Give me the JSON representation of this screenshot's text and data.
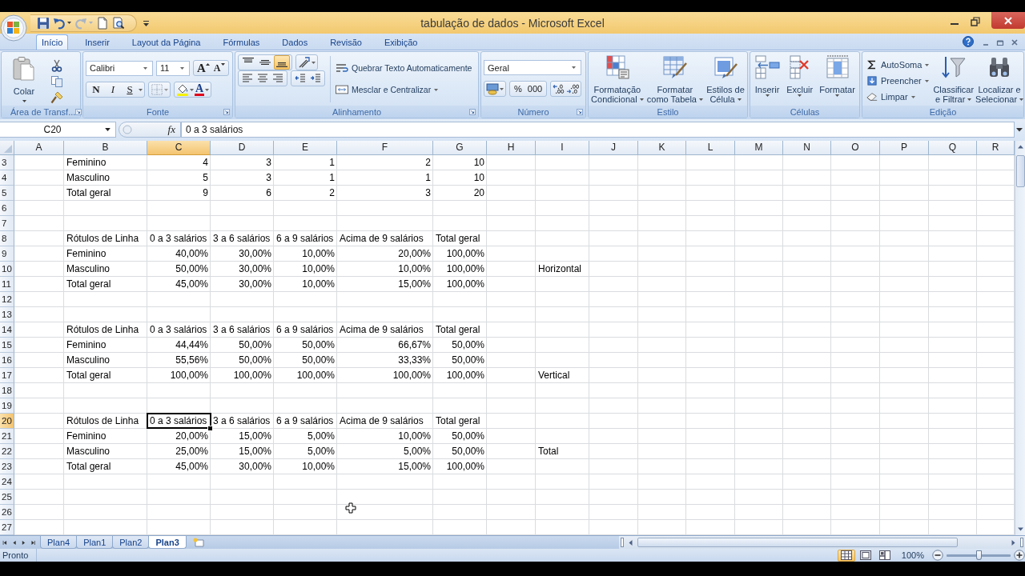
{
  "window": {
    "title": "tabulação de dados - Microsoft Excel"
  },
  "quick_access": [
    {
      "kind": "save",
      "disabled": false
    },
    {
      "kind": "undo",
      "disabled": false
    },
    {
      "kind": "redo",
      "disabled": true
    },
    {
      "kind": "new",
      "disabled": false
    },
    {
      "kind": "print_preview",
      "disabled": false
    }
  ],
  "tabs": [
    {
      "label": "Início",
      "selected": true
    },
    {
      "label": "Inserir",
      "selected": false
    },
    {
      "label": "Layout da Página",
      "selected": false
    },
    {
      "label": "Fórmulas",
      "selected": false
    },
    {
      "label": "Dados",
      "selected": false
    },
    {
      "label": "Revisão",
      "selected": false
    },
    {
      "label": "Exibição",
      "selected": false
    }
  ],
  "ribbon": {
    "clipboard": {
      "label": "Área de Transf...",
      "paste": "Colar"
    },
    "font": {
      "label": "Fonte",
      "font_name": "Calibri",
      "font_size": "11",
      "grow": "A",
      "shrink": "A",
      "styles": [
        "N",
        "I",
        "S"
      ],
      "font_color": "A"
    },
    "alignment": {
      "label": "Alinhamento",
      "vertical": [
        {
          "kind": "top",
          "selected": false
        },
        {
          "kind": "middle",
          "selected": false
        },
        {
          "kind": "bottom",
          "selected": true
        }
      ],
      "wrap": "Quebrar Texto Automaticamente",
      "merge": "Mesclar e Centralizar"
    },
    "number": {
      "label": "Número",
      "format": "Geral",
      "percent": "%",
      "thousands": "000"
    },
    "styles": {
      "label": "Estilo",
      "buttons": [
        {
          "lines": [
            "Formatação",
            "Condicional"
          ]
        },
        {
          "lines": [
            "Formatar",
            "como Tabela"
          ]
        },
        {
          "lines": [
            "Estilos de",
            "Célula"
          ]
        }
      ]
    },
    "cells": {
      "label": "Células",
      "buttons": [
        "Inserir",
        "Excluir",
        "Formatar"
      ]
    },
    "editing": {
      "label": "Edição",
      "small": [
        "AutoSoma",
        "Preencher",
        "Limpar"
      ],
      "big": [
        {
          "lines": [
            "Classificar",
            "e Filtrar"
          ]
        },
        {
          "lines": [
            "Localizar e",
            "Selecionar"
          ]
        }
      ]
    }
  },
  "formula_bar": {
    "name_box": "C20",
    "function_button": "fx",
    "formula": "0 a 3 salários"
  },
  "columns": [
    {
      "label": "A",
      "selected": false
    },
    {
      "label": "B",
      "selected": false
    },
    {
      "label": "C",
      "selected": true
    },
    {
      "label": "D",
      "selected": false
    },
    {
      "label": "E",
      "selected": false
    },
    {
      "label": "F",
      "selected": false
    },
    {
      "label": "G",
      "selected": false
    },
    {
      "label": "H",
      "selected": false
    },
    {
      "label": "I",
      "selected": false
    },
    {
      "label": "J",
      "selected": false
    },
    {
      "label": "K",
      "selected": false
    },
    {
      "label": "L",
      "selected": false
    },
    {
      "label": "M",
      "selected": false
    },
    {
      "label": "N",
      "selected": false
    },
    {
      "label": "O",
      "selected": false
    },
    {
      "label": "P",
      "selected": false
    },
    {
      "label": "Q",
      "selected": false
    },
    {
      "label": "R",
      "selected": false
    }
  ],
  "rows": [
    {
      "number": "3",
      "selected": false,
      "cells": [
        null,
        {
          "text": "Feminino",
          "kind": "text"
        },
        {
          "text": "4",
          "kind": "number"
        },
        {
          "text": "3",
          "kind": "number"
        },
        {
          "text": "1",
          "kind": "number"
        },
        {
          "text": "2",
          "kind": "number"
        },
        {
          "text": "10",
          "kind": "number"
        }
      ]
    },
    {
      "number": "4",
      "selected": false,
      "cells": [
        null,
        {
          "text": "Masculino",
          "kind": "text"
        },
        {
          "text": "5",
          "kind": "number"
        },
        {
          "text": "3",
          "kind": "number"
        },
        {
          "text": "1",
          "kind": "number"
        },
        {
          "text": "1",
          "kind": "number"
        },
        {
          "text": "10",
          "kind": "number"
        }
      ]
    },
    {
      "number": "5",
      "selected": false,
      "cells": [
        null,
        {
          "text": "Total geral",
          "kind": "text"
        },
        {
          "text": "9",
          "kind": "number"
        },
        {
          "text": "6",
          "kind": "number"
        },
        {
          "text": "2",
          "kind": "number"
        },
        {
          "text": "3",
          "kind": "number"
        },
        {
          "text": "20",
          "kind": "number"
        }
      ]
    },
    {
      "number": "6",
      "selected": false
    },
    {
      "number": "7",
      "selected": false
    },
    {
      "number": "8",
      "selected": false,
      "cells": [
        null,
        {
          "text": "Rótulos de Linha",
          "kind": "text"
        },
        {
          "text": "0 a 3 salários",
          "kind": "text"
        },
        {
          "text": "3 a 6 salários",
          "kind": "text"
        },
        {
          "text": "6 a 9 salários",
          "kind": "text"
        },
        {
          "text": "Acima de 9 salários",
          "kind": "text"
        },
        {
          "text": "Total geral",
          "kind": "text"
        }
      ]
    },
    {
      "number": "9",
      "selected": false,
      "cells": [
        null,
        {
          "text": "Feminino",
          "kind": "text"
        },
        {
          "text": "40,00%",
          "kind": "number"
        },
        {
          "text": "30,00%",
          "kind": "number"
        },
        {
          "text": "10,00%",
          "kind": "number"
        },
        {
          "text": "20,00%",
          "kind": "number"
        },
        {
          "text": "100,00%",
          "kind": "number"
        }
      ]
    },
    {
      "number": "10",
      "selected": false,
      "cells": [
        null,
        {
          "text": "Masculino",
          "kind": "text"
        },
        {
          "text": "50,00%",
          "kind": "number"
        },
        {
          "text": "30,00%",
          "kind": "number"
        },
        {
          "text": "10,00%",
          "kind": "number"
        },
        {
          "text": "10,00%",
          "kind": "number"
        },
        {
          "text": "100,00%",
          "kind": "number"
        },
        null,
        {
          "text": "Horizontal",
          "kind": "text"
        }
      ]
    },
    {
      "number": "11",
      "selected": false,
      "cells": [
        null,
        {
          "text": "Total geral",
          "kind": "text"
        },
        {
          "text": "45,00%",
          "kind": "number"
        },
        {
          "text": "30,00%",
          "kind": "number"
        },
        {
          "text": "10,00%",
          "kind": "number"
        },
        {
          "text": "15,00%",
          "kind": "number"
        },
        {
          "text": "100,00%",
          "kind": "number"
        }
      ]
    },
    {
      "number": "12",
      "selected": false
    },
    {
      "number": "13",
      "selected": false
    },
    {
      "number": "14",
      "selected": false,
      "cells": [
        null,
        {
          "text": "Rótulos de Linha",
          "kind": "text"
        },
        {
          "text": "0 a 3 salários",
          "kind": "text"
        },
        {
          "text": "3 a 6 salários",
          "kind": "text"
        },
        {
          "text": "6 a 9 salários",
          "kind": "text"
        },
        {
          "text": "Acima de 9 salários",
          "kind": "text"
        },
        {
          "text": "Total geral",
          "kind": "text"
        }
      ]
    },
    {
      "number": "15",
      "selected": false,
      "cells": [
        null,
        {
          "text": "Feminino",
          "kind": "text"
        },
        {
          "text": "44,44%",
          "kind": "number"
        },
        {
          "text": "50,00%",
          "kind": "number"
        },
        {
          "text": "50,00%",
          "kind": "number"
        },
        {
          "text": "66,67%",
          "kind": "number"
        },
        {
          "text": "50,00%",
          "kind": "number"
        }
      ]
    },
    {
      "number": "16",
      "selected": false,
      "cells": [
        null,
        {
          "text": "Masculino",
          "kind": "text"
        },
        {
          "text": "55,56%",
          "kind": "number"
        },
        {
          "text": "50,00%",
          "kind": "number"
        },
        {
          "text": "50,00%",
          "kind": "number"
        },
        {
          "text": "33,33%",
          "kind": "number"
        },
        {
          "text": "50,00%",
          "kind": "number"
        }
      ]
    },
    {
      "number": "17",
      "selected": false,
      "cells": [
        null,
        {
          "text": "Total geral",
          "kind": "text"
        },
        {
          "text": "100,00%",
          "kind": "number"
        },
        {
          "text": "100,00%",
          "kind": "number"
        },
        {
          "text": "100,00%",
          "kind": "number"
        },
        {
          "text": "100,00%",
          "kind": "number"
        },
        {
          "text": "100,00%",
          "kind": "number"
        },
        null,
        {
          "text": "Vertical",
          "kind": "text"
        }
      ]
    },
    {
      "number": "18",
      "selected": false
    },
    {
      "number": "19",
      "selected": false
    },
    {
      "number": "20",
      "selected": true,
      "cells": [
        null,
        {
          "text": "Rótulos de Linha",
          "kind": "text"
        },
        {
          "text": "0 a 3 salários",
          "kind": "text"
        },
        {
          "text": "3 a 6 salários",
          "kind": "text"
        },
        {
          "text": "6 a 9 salários",
          "kind": "text"
        },
        {
          "text": "Acima de 9 salários",
          "kind": "text"
        },
        {
          "text": "Total geral",
          "kind": "text"
        }
      ]
    },
    {
      "number": "21",
      "selected": false,
      "cells": [
        null,
        {
          "text": "Feminino",
          "kind": "text"
        },
        {
          "text": "20,00%",
          "kind": "number"
        },
        {
          "text": "15,00%",
          "kind": "number"
        },
        {
          "text": "5,00%",
          "kind": "number"
        },
        {
          "text": "10,00%",
          "kind": "number"
        },
        {
          "text": "50,00%",
          "kind": "number"
        }
      ]
    },
    {
      "number": "22",
      "selected": false,
      "cells": [
        null,
        {
          "text": "Masculino",
          "kind": "text"
        },
        {
          "text": "25,00%",
          "kind": "number"
        },
        {
          "text": "15,00%",
          "kind": "number"
        },
        {
          "text": "5,00%",
          "kind": "number"
        },
        {
          "text": "5,00%",
          "kind": "number"
        },
        {
          "text": "50,00%",
          "kind": "number"
        },
        null,
        {
          "text": "Total",
          "kind": "text"
        }
      ]
    },
    {
      "number": "23",
      "selected": false,
      "cells": [
        null,
        {
          "text": "Total geral",
          "kind": "text"
        },
        {
          "text": "45,00%",
          "kind": "number"
        },
        {
          "text": "30,00%",
          "kind": "number"
        },
        {
          "text": "10,00%",
          "kind": "number"
        },
        {
          "text": "15,00%",
          "kind": "number"
        },
        {
          "text": "100,00%",
          "kind": "number"
        }
      ]
    },
    {
      "number": "24",
      "selected": false
    },
    {
      "number": "25",
      "selected": false
    },
    {
      "number": "26",
      "selected": false
    },
    {
      "number": "27",
      "selected": false
    }
  ],
  "sheet_tabs": [
    {
      "label": "Plan4",
      "selected": false
    },
    {
      "label": "Plan1",
      "selected": false
    },
    {
      "label": "Plan2",
      "selected": false
    },
    {
      "label": "Plan3",
      "selected": true
    }
  ],
  "status_bar": {
    "status": "Pronto",
    "views": [
      {
        "kind": "normal",
        "selected": true
      },
      {
        "kind": "page_layout",
        "selected": false
      },
      {
        "kind": "page_break",
        "selected": false
      }
    ],
    "zoom": "100%",
    "zoom_slider": {
      "level": 0.5
    }
  }
}
